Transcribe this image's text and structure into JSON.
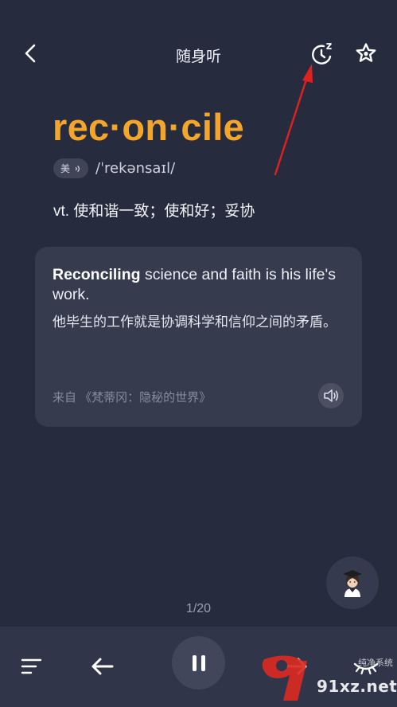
{
  "header": {
    "title": "随身听",
    "back_icon": "chevron-left-icon",
    "timer_icon": "sleep-timer-icon",
    "favorite_icon": "star-icon"
  },
  "word": {
    "headword": "rec·on·cile",
    "accent": "美",
    "phonetic": "/ˈrekənsaɪl/",
    "definition": "vt. 使和谐一致；使和好；妥协"
  },
  "example": {
    "highlight": "Reconciling",
    "sentence_rest": " science and faith is his life's work.",
    "translation": "他毕生的工作就是协调科学和信仰之间的矛盾。",
    "source": "来自 《梵蒂冈：隐秘的世界》",
    "speaker_icon": "speaker-icon"
  },
  "progress": "1/20",
  "controls": {
    "list_icon": "playlist-icon",
    "prev_icon": "arrow-left-icon",
    "play_state_icon": "pause-icon",
    "next_icon": "arrow-right-icon",
    "hide_icon": "eye-closed-icon"
  },
  "watermark": {
    "text": "91xz.net",
    "label": "纯净系统"
  },
  "colors": {
    "background": "#262b3e",
    "card": "#363b4e",
    "accent": "#f4a62a",
    "bottom_bar": "#303549",
    "annotation": "#e0221e"
  }
}
